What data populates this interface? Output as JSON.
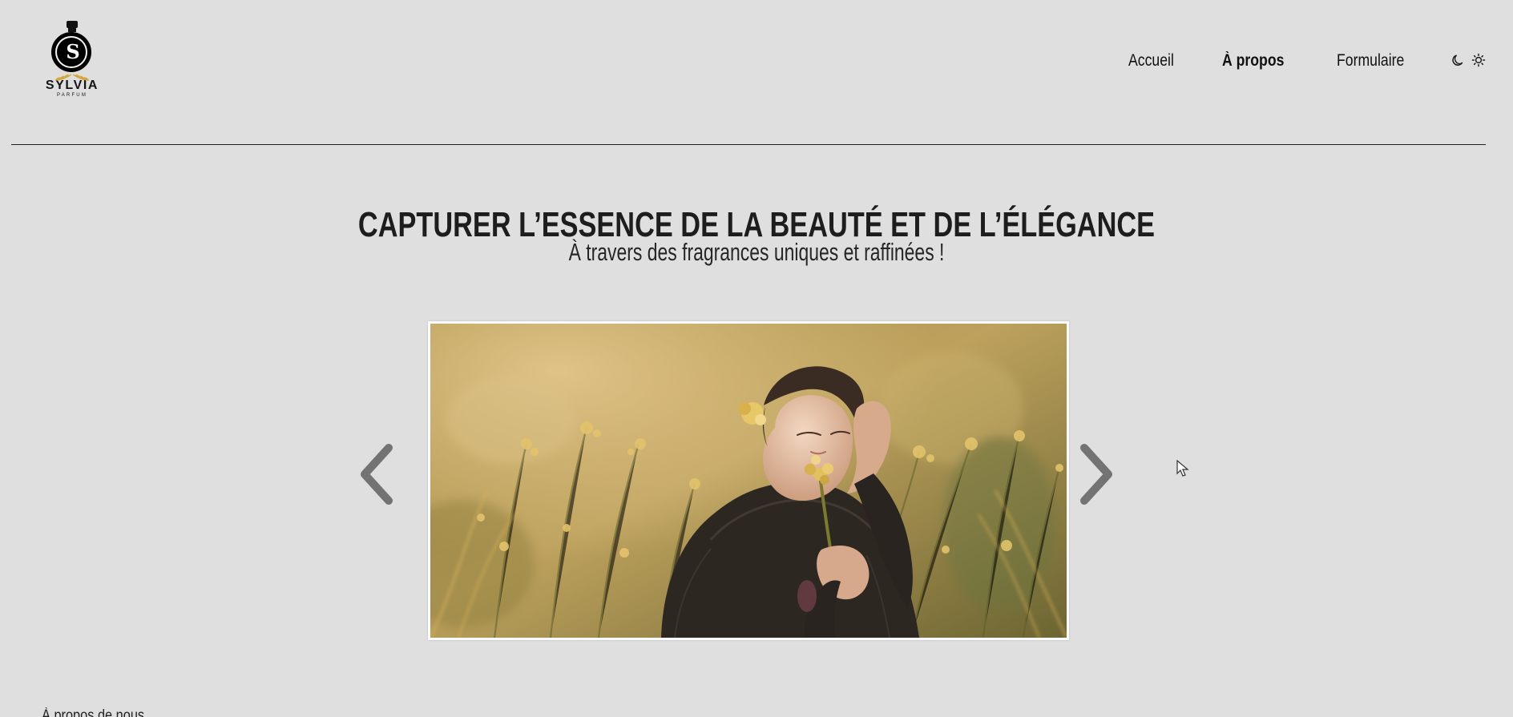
{
  "brand": {
    "name": "SYLVIA",
    "subtitle": "PARFUM",
    "logo_letter": "S",
    "accent_color": "#d4a637"
  },
  "nav": {
    "items": [
      {
        "label": "Accueil",
        "active": false
      },
      {
        "label": "À propos",
        "active": true
      },
      {
        "label": "Formulaire",
        "active": false
      }
    ],
    "theme_icons": [
      "moon-icon",
      "sun-icon"
    ]
  },
  "hero": {
    "title": "CAPTURER L’ESSENCE DE LA BEAUTÉ ET DE L’ÉLÉGANCE",
    "subtitle": "À travers des fragrances uniques et raffinées !"
  },
  "carousel": {
    "prev_icon": "chevron-left-icon",
    "next_icon": "chevron-right-icon"
  },
  "footer": {
    "about_title": "À propos de nous"
  }
}
